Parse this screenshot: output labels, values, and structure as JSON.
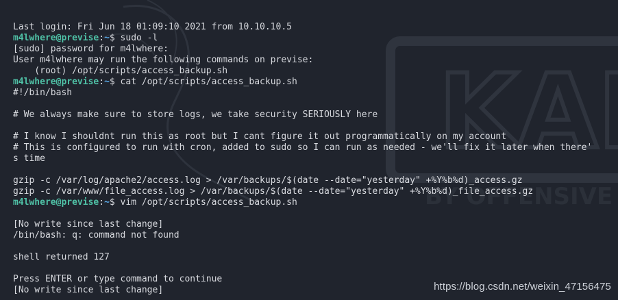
{
  "terminal": {
    "lines": [
      {
        "type": "text",
        "text": "Last login: Fri Jun 18 01:09:10 2021 from 10.10.10.5"
      },
      {
        "type": "prompt",
        "user": "m4lwhere@previse",
        "path": "~",
        "sym": "$ ",
        "cmd": "sudo -l"
      },
      {
        "type": "text",
        "text": "[sudo] password for m4lwhere:"
      },
      {
        "type": "text",
        "text": "User m4lwhere may run the following commands on previse:"
      },
      {
        "type": "text",
        "text": "    (root) /opt/scripts/access_backup.sh"
      },
      {
        "type": "prompt",
        "user": "m4lwhere@previse",
        "path": "~",
        "sym": "$ ",
        "cmd": "cat /opt/scripts/access_backup.sh"
      },
      {
        "type": "text",
        "text": "#!/bin/bash"
      },
      {
        "type": "text",
        "text": ""
      },
      {
        "type": "text",
        "text": "# We always make sure to store logs, we take security SERIOUSLY here"
      },
      {
        "type": "text",
        "text": ""
      },
      {
        "type": "text",
        "text": "# I know I shouldnt run this as root but I cant figure it out programmatically on my account"
      },
      {
        "type": "text",
        "text": "# This is configured to run with cron, added to sudo so I can run as needed - we'll fix it later when there'"
      },
      {
        "type": "text",
        "text": "s time"
      },
      {
        "type": "text",
        "text": ""
      },
      {
        "type": "text",
        "text": "gzip -c /var/log/apache2/access.log > /var/backups/$(date --date=\"yesterday\" +%Y%b%d)_access.gz"
      },
      {
        "type": "text",
        "text": "gzip -c /var/www/file_access.log > /var/backups/$(date --date=\"yesterday\" +%Y%b%d)_file_access.gz"
      },
      {
        "type": "prompt",
        "user": "m4lwhere@previse",
        "path": "~",
        "sym": "$ ",
        "cmd": "vim /opt/scripts/access_backup.sh"
      },
      {
        "type": "text",
        "text": ""
      },
      {
        "type": "text",
        "text": "[No write since last change]"
      },
      {
        "type": "text",
        "text": "/bin/bash: q: command not found"
      },
      {
        "type": "text",
        "text": ""
      },
      {
        "type": "text",
        "text": "shell returned 127"
      },
      {
        "type": "text",
        "text": ""
      },
      {
        "type": "text",
        "text": "Press ENTER or type command to continue"
      },
      {
        "type": "text",
        "text": "[No write since last change]"
      }
    ]
  },
  "watermark": {
    "text": "https://blog.csdn.net/weixin_47156475"
  },
  "background": {
    "logo_text": "KALI",
    "tagline": "BY OFFENSIVE SECURITY",
    "colors": {
      "bg": "#20242d",
      "art": "#2b3039",
      "prompt_user": "#4fc1a6",
      "prompt_path": "#5aa9e6",
      "text": "#d8dadf"
    }
  }
}
